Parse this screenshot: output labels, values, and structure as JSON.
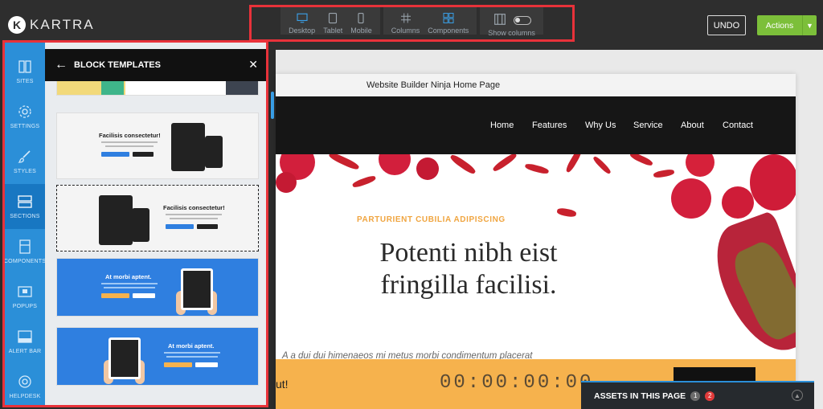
{
  "app": {
    "logo_text": "KARTRA"
  },
  "toolbar": {
    "items": [
      {
        "label": "Desktop",
        "icon": "desktop-icon"
      },
      {
        "label": "Tablet",
        "icon": "tablet-icon"
      },
      {
        "label": "Mobile",
        "icon": "mobile-icon"
      },
      {
        "label": "Columns",
        "icon": "columns-icon"
      },
      {
        "label": "Components",
        "icon": "components-icon"
      },
      {
        "label": "Show columns",
        "icon": "show-columns-icon"
      }
    ],
    "undo_label": "UNDO",
    "actions_label": "Actions"
  },
  "sidebar": {
    "items": [
      {
        "label": "SITES",
        "icon": "sites-icon"
      },
      {
        "label": "SETTINGS",
        "icon": "gear-icon"
      },
      {
        "label": "STYLES",
        "icon": "brush-icon"
      },
      {
        "label": "SECTIONS",
        "icon": "sections-icon"
      },
      {
        "label": "COMPONENTS",
        "icon": "components-icon"
      },
      {
        "label": "POPUPS",
        "icon": "popup-icon"
      },
      {
        "label": "ALERT BAR",
        "icon": "alert-bar-icon"
      },
      {
        "label": "HELPDESK",
        "icon": "lifebuoy-icon"
      }
    ],
    "active_index": 3
  },
  "panel": {
    "title": "BLOCK TEMPLATES",
    "templates": [
      {
        "heading": ""
      },
      {
        "heading": "Facilisis consectetur!"
      },
      {
        "heading": "Facilisis consectetur!"
      },
      {
        "heading": "At morbi aptent."
      },
      {
        "heading": "At morbi aptent."
      }
    ]
  },
  "canvas": {
    "page_title": "Website Builder Ninja Home Page",
    "nav": [
      "Home",
      "Features",
      "Why Us",
      "Service",
      "About",
      "Contact"
    ],
    "kicker": "PARTURIENT CUBILIA ADIPISCING",
    "headline_1": "Potenti nibh eist",
    "headline_2": "fringilla facilisi.",
    "subline": "A a dui dui himenaeos mi metus morbi condimentum placerat",
    "countdown_lead": "ut!",
    "countdown": "00:00:00:00"
  },
  "assets": {
    "label": "ASSETS IN THIS PAGE",
    "count_1": "1",
    "count_2": "2"
  },
  "colors": {
    "brand_blue": "#2b8fd8",
    "highlight_red": "#e8323a",
    "actions_green": "#7cbf3a",
    "kicker_orange": "#f0a540",
    "countdown_orange": "#f6b24d"
  }
}
